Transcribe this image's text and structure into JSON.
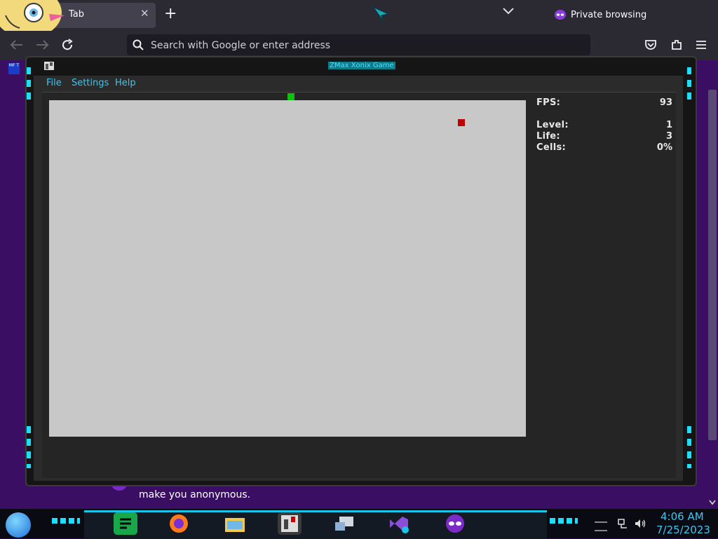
{
  "browser": {
    "tab_label": "Tab",
    "close_glyph": "✕",
    "new_tab_glyph": "+",
    "private_label": "Private browsing",
    "url_placeholder": "Search with Google or enter address",
    "bookmark_label": "MF T",
    "page_text": "make you anonymous.",
    "icons": [
      "back-icon",
      "forward-icon",
      "reload-icon",
      "search-icon",
      "pocket-icon",
      "extensions-icon",
      "menu-icon",
      "private-mask-icon"
    ]
  },
  "game": {
    "title": "ZMax Xonix Game",
    "menu": [
      "File",
      "Settings",
      "Help"
    ],
    "stats": [
      {
        "label": "FPS:",
        "value": "93"
      },
      {
        "label": "Level:",
        "value": "1"
      },
      {
        "label": "Life:",
        "value": "3"
      },
      {
        "label": "Cells:",
        "value": "0%"
      }
    ],
    "colors": {
      "field": "#c8c8c8",
      "player": "#10c010",
      "enemy": "#c00000",
      "accent": "#19e0ff"
    }
  },
  "taskbar": {
    "time": "4:06 AM",
    "date": "7/25/2023",
    "apps": [
      "chat-app-icon",
      "firefox-icon",
      "file-explorer-icon",
      "game-app-icon",
      "network-app-icon",
      "visual-studio-icon",
      "private-browsing-icon"
    ]
  }
}
